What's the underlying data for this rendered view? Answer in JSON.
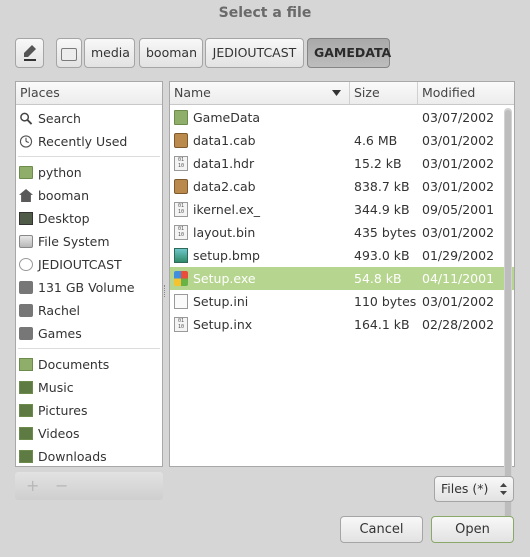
{
  "window": {
    "title": "Select a file"
  },
  "pathbar": {
    "segments": [
      "media",
      "booman",
      "JEDIOUTCAST",
      "GAMEDATA"
    ],
    "active_index": 3
  },
  "places": {
    "header": "Places",
    "group1": [
      {
        "label": "Search",
        "icon": "search-icon"
      },
      {
        "label": "Recently Used",
        "icon": "clock-icon"
      }
    ],
    "group2": [
      {
        "label": "python",
        "icon": "folder-icon"
      },
      {
        "label": "booman",
        "icon": "home-icon"
      },
      {
        "label": "Desktop",
        "icon": "desktop-icon"
      },
      {
        "label": "File System",
        "icon": "filesystem-icon"
      },
      {
        "label": "JEDIOUTCAST",
        "icon": "cdrom-icon"
      },
      {
        "label": "131 GB Volume",
        "icon": "drive-icon"
      },
      {
        "label": "Rachel",
        "icon": "drive-icon"
      },
      {
        "label": "Games",
        "icon": "drive-icon"
      }
    ],
    "group3": [
      {
        "label": "Documents",
        "icon": "documents-folder-icon"
      },
      {
        "label": "Music",
        "icon": "music-folder-icon"
      },
      {
        "label": "Pictures",
        "icon": "pictures-folder-icon"
      },
      {
        "label": "Videos",
        "icon": "videos-folder-icon"
      },
      {
        "label": "Downloads",
        "icon": "downloads-folder-icon"
      }
    ],
    "add_label": "+",
    "remove_label": "−"
  },
  "files": {
    "columns": {
      "name": "Name",
      "size": "Size",
      "modified": "Modified"
    },
    "rows": [
      {
        "name": "GameData",
        "size": "",
        "modified": "03/07/2002",
        "icon": "folder-icon"
      },
      {
        "name": "data1.cab",
        "size": "4.6 MB",
        "modified": "03/01/2002",
        "icon": "archive-icon"
      },
      {
        "name": "data1.hdr",
        "size": "15.2 kB",
        "modified": "03/01/2002",
        "icon": "binary-file-icon"
      },
      {
        "name": "data2.cab",
        "size": "838.7 kB",
        "modified": "03/01/2002",
        "icon": "archive-icon"
      },
      {
        "name": "ikernel.ex_",
        "size": "344.9 kB",
        "modified": "09/05/2001",
        "icon": "binary-file-icon"
      },
      {
        "name": "layout.bin",
        "size": "435 bytes",
        "modified": "03/01/2002",
        "icon": "binary-file-icon"
      },
      {
        "name": "setup.bmp",
        "size": "493.0 kB",
        "modified": "01/29/2002",
        "icon": "image-file-icon"
      },
      {
        "name": "Setup.exe",
        "size": "54.8 kB",
        "modified": "04/11/2001",
        "icon": "windows-exe-icon"
      },
      {
        "name": "Setup.ini",
        "size": "110 bytes",
        "modified": "03/01/2002",
        "icon": "text-file-icon"
      },
      {
        "name": "Setup.inx",
        "size": "164.1 kB",
        "modified": "02/28/2002",
        "icon": "binary-file-icon"
      }
    ],
    "selected_index": 7
  },
  "filter": {
    "value": "Files (*)"
  },
  "actions": {
    "cancel": "Cancel",
    "open": "Open"
  },
  "colors": {
    "selection": "#b6d58f",
    "background": "#d6d6d6"
  }
}
